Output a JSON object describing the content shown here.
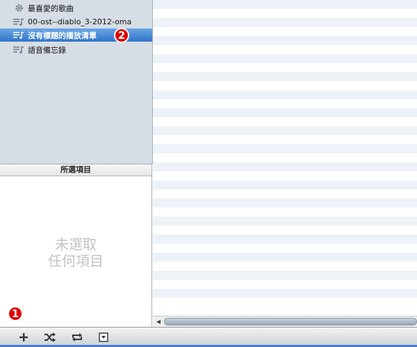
{
  "sidebar": {
    "items": [
      {
        "label": "最喜愛的歌曲",
        "icon": "gear-icon"
      },
      {
        "label": "00-ost--diablo_3-2012-oma",
        "icon": "playlist-icon"
      },
      {
        "label": "沒有標題的播放清單",
        "icon": "playlist-icon",
        "selected": true
      },
      {
        "label": "語音備忘錄",
        "icon": "playlist-icon"
      }
    ]
  },
  "selected_panel": {
    "header": "所選項目",
    "empty_line1": "未選取",
    "empty_line2": "任何項目"
  },
  "annotations": {
    "badge_1": "1",
    "badge_2": "2"
  },
  "toolbar": {
    "buttons": [
      "add-icon",
      "shuffle-icon",
      "repeat-icon",
      "show-artwork-icon"
    ]
  },
  "colors": {
    "selection": "#2f74c8",
    "sidebar_bg": "#d6dde5",
    "stripe": "#edf2f8",
    "badge": "#e00000"
  }
}
